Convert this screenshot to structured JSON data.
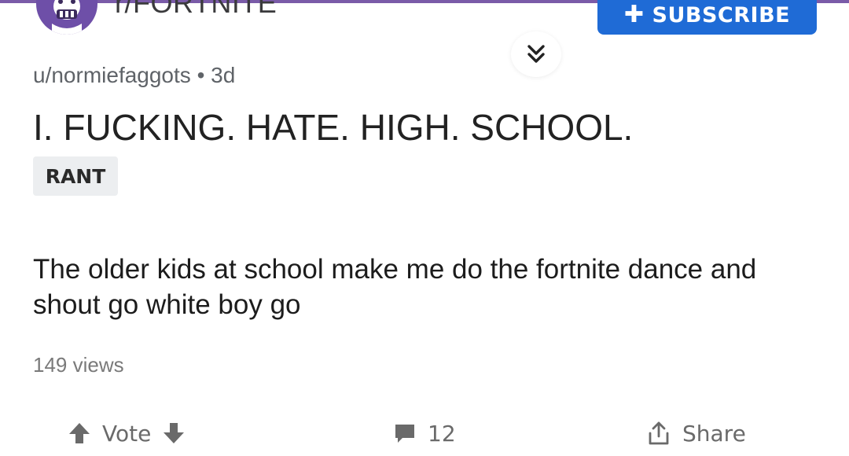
{
  "header": {
    "subreddit_name": "r/FORTNITE",
    "subscribe_label": "SUBSCRIBE",
    "subscribe_icon": "plus-icon",
    "collapse_icon": "double-chevron-down-icon"
  },
  "post": {
    "author": "u/normiefaggots",
    "separator": "•",
    "age": "3d",
    "title": "I. FUCKING. HATE. HIGH. SCHOOL.",
    "flair": "RANT",
    "body": "The older kids at school make me do the fortnite dance and shout go white boy go",
    "views": "149 views"
  },
  "actions": {
    "vote_label": "Vote",
    "comment_count": "12",
    "share_label": "Share"
  },
  "colors": {
    "subscribe_bg": "#1f6bd6",
    "avatar_bg": "#6e4fa8",
    "flair_bg": "#eceef0",
    "top_strip": "#7a5ba8"
  }
}
